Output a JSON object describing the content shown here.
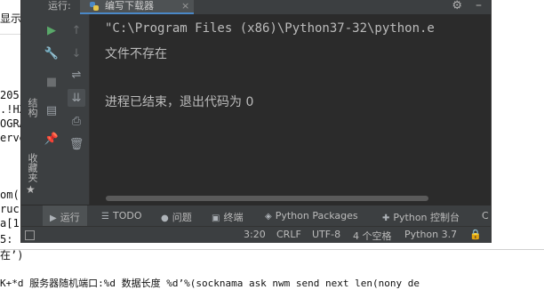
{
  "background_editor": {
    "lines": [
      "显示",
      "205’",
      ".!HX",
      "OGRA",
      "erve",
      "om(1",
      "ruc",
      "a[1]",
      "5:",
      "在’)",
      "K+*d 服务器随机端口:%d 数据长度 %d’%(socknama ask nwm send next len(nony de"
    ]
  },
  "run_panel": {
    "label": "运行:",
    "tab_title": "编写下载器",
    "left_strip": {
      "structure": "结构",
      "favorites": "收藏夹"
    }
  },
  "console": {
    "lines": [
      "\"C:\\Program Files (x86)\\Python37-32\\python.e",
      "文件不存在",
      "",
      "进程已结束，退出代码为 0"
    ]
  },
  "bottom_tabs": [
    {
      "label": "运行",
      "icon": "▶"
    },
    {
      "label": "TODO",
      "icon": "☰"
    },
    {
      "label": "问题",
      "icon": "●"
    },
    {
      "label": "终端",
      "icon": "▣"
    },
    {
      "label": "Python Packages",
      "icon": "◈"
    },
    {
      "label": "Python 控制台",
      "icon": "✚"
    },
    {
      "label": "C",
      "icon": ""
    }
  ],
  "status_bar": {
    "position": "3:20",
    "line_ending": "CRLF",
    "encoding": "UTF-8",
    "indent": "4 个空格",
    "interpreter": "Python 3.7"
  },
  "colors": {
    "ide_background": "#2b2b2b",
    "panel": "#3c3f41",
    "run_green": "#59a869",
    "accent_blue": "#4a88c7"
  }
}
